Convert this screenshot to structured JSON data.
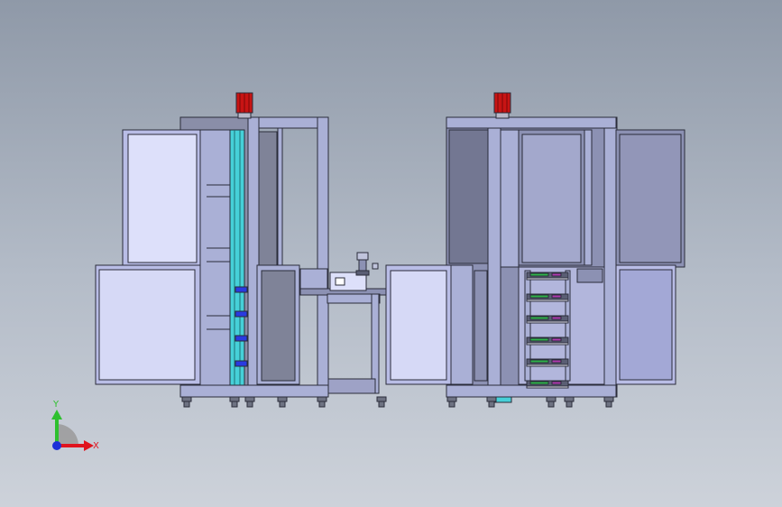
{
  "viewport": {
    "background_top": "#8f99a8",
    "background_bottom": "#cdd2da"
  },
  "model": {
    "colors": {
      "frame": "#aab0d6",
      "frame_edge": "#2a2c3a",
      "panel_light": "#dde0fa",
      "panel_mid": "#b9bde6",
      "panel_dark": "#7f8398",
      "panel_steel": "#8c91b3",
      "motor": "#c81414",
      "rail": "#46d0d8",
      "shelf_accent": "#b03ab0",
      "shelf_green": "#2fb34a"
    },
    "tray_count": 6,
    "left_motor_icon": "motor-icon",
    "right_motor_icon": "motor-icon"
  },
  "triad": {
    "x_label": "X",
    "y_label": "Y",
    "x_color": "#e0141e",
    "y_color": "#2ec02e",
    "z_color": "#1c2fd8"
  }
}
